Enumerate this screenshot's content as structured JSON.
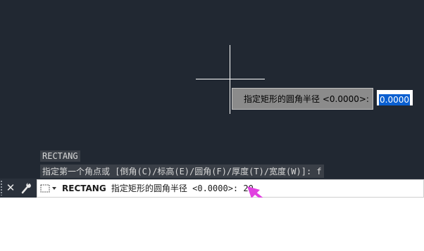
{
  "dynamic_input": {
    "prompt": "指定矩形的圆角半径 <0.0000>:",
    "value": "0.0000"
  },
  "command_history": [
    "RECTANG",
    "指定第一个角点或 [倒角(C)/标高(E)/圆角(F)/厚度(T)/宽度(W)]: f"
  ],
  "command_line": {
    "command_name": "RECTANG",
    "prompt": " 指定矩形的圆角半径 <0.0000>: ",
    "typed_value": "20"
  },
  "icons": {
    "close": "close-icon",
    "customize": "wrench-icon",
    "recent": "recent-commands-dropdown-icon",
    "annotation": "pointer-arrow-icon"
  },
  "colors": {
    "canvas_bg": "#212832",
    "selection": "#0a5fd0",
    "annotation_arrow": "#e040e0"
  }
}
